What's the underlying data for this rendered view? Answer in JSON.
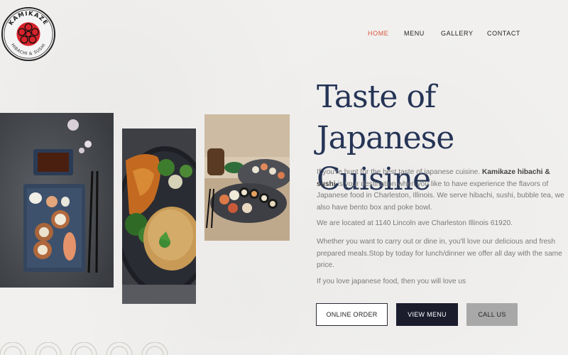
{
  "brand": {
    "name": "KAMIKAZE",
    "tagline": "HIBACHI & SUSHI",
    "colors": {
      "red": "#d7232b",
      "navy": "#253455",
      "accent": "#d9533b"
    }
  },
  "nav": {
    "items": [
      {
        "label": "HOME",
        "active": true
      },
      {
        "label": "MENU",
        "active": false
      },
      {
        "label": "GALLERY",
        "active": false
      },
      {
        "label": "CONTACT",
        "active": false
      }
    ]
  },
  "hero": {
    "title_line1": "Taste of Japanese",
    "title_line2": "Cuisine",
    "p1_before": "If you're hunt for the best taste of japanese cuisine. ",
    "p1_bold": "Kamikaze hibachi & sushi",
    "p1_after": " is your destination when you like to have experience the flavors of Japanese food in Charleston, Illinois. We serve hibachi, sushi, bubble tea, we also have bento box and poke bowl.",
    "p2": "We are located at 1140 Lincoln ave Charleston Illinois 61920.",
    "p3": "Whether you want to carry out or dine in, you'll love our delicious and fresh prepared meals.Stop by today for lunch/dinner we offer all day with the same price.",
    "p4": "If you love japanese food, then you will love us"
  },
  "buttons": {
    "order": "ONLINE ORDER",
    "menu": "VIEW MENU",
    "call": "CALL US"
  },
  "images": [
    {
      "name": "sushi-platter-photo"
    },
    {
      "name": "hibachi-chicken-rice-photo"
    },
    {
      "name": "sushi-rolls-plate-photo"
    }
  ]
}
